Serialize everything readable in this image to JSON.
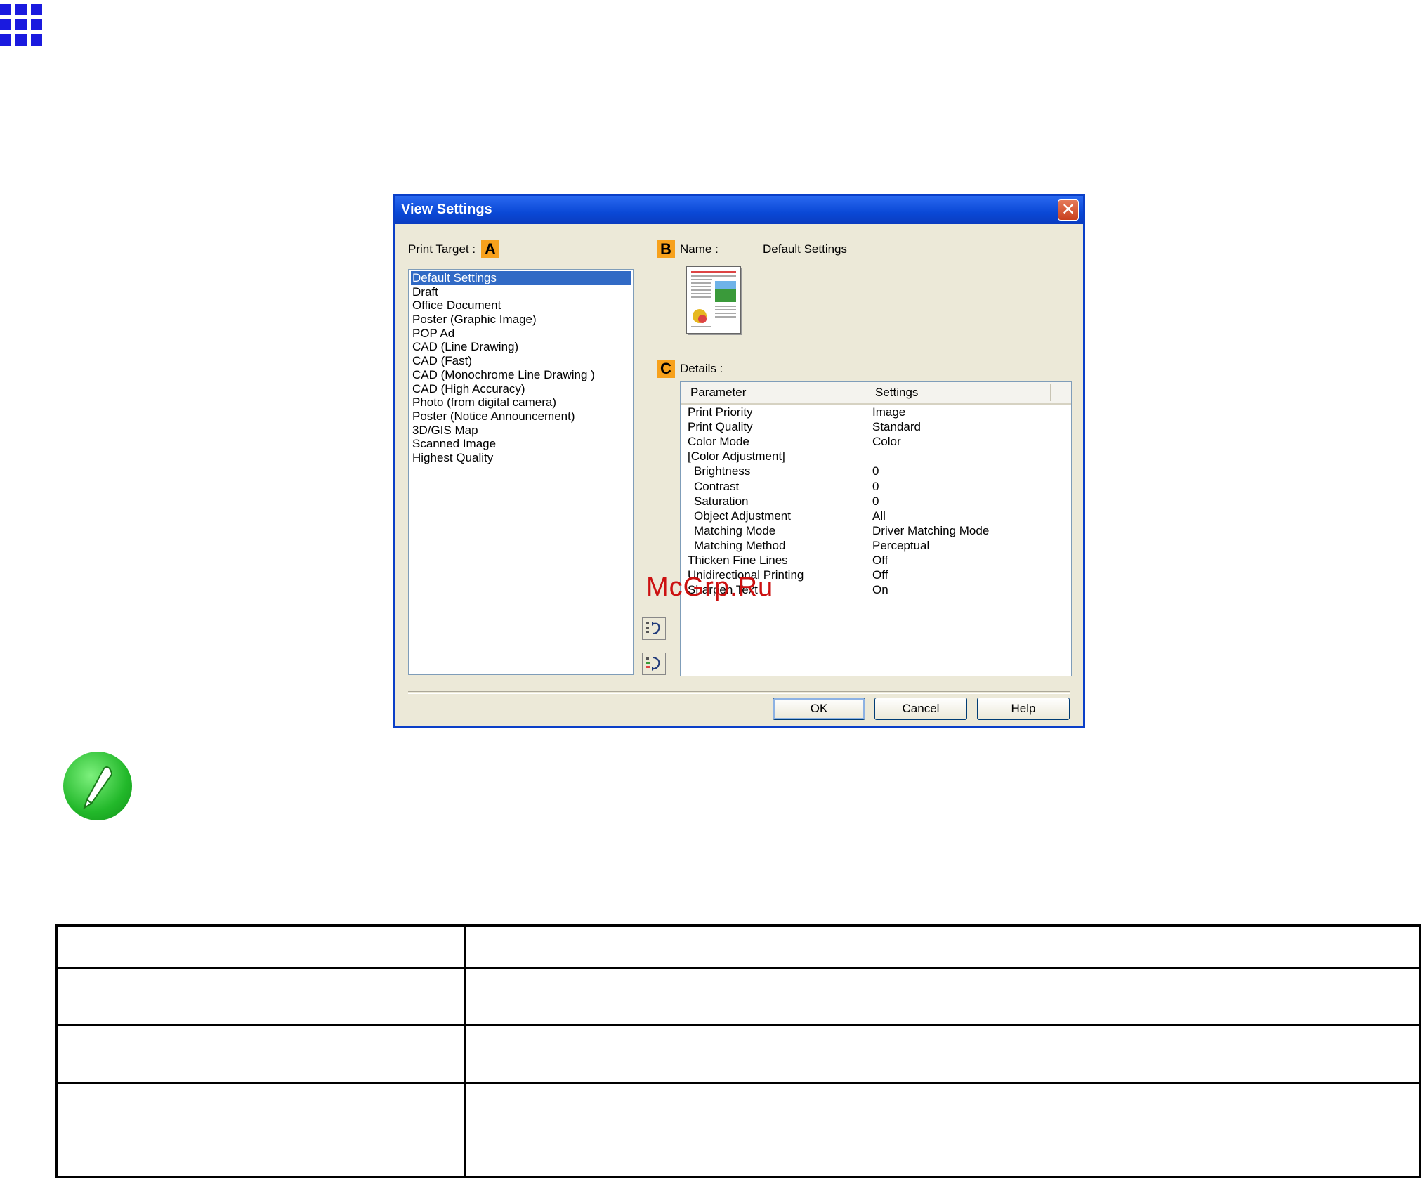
{
  "dialog": {
    "title": "View Settings",
    "close_glyph": "✕"
  },
  "print_target": {
    "label": "Print Target :",
    "badge": "A",
    "items": [
      "Default Settings",
      "Draft",
      "Office Document",
      "Poster (Graphic Image)",
      "POP Ad",
      "CAD (Line Drawing)",
      "CAD (Fast)",
      "CAD (Monochrome Line Drawing )",
      "CAD (High Accuracy)",
      "Photo (from digital camera)",
      "Poster (Notice Announcement)",
      "3D/GIS Map",
      "Scanned Image",
      "Highest Quality"
    ],
    "selected_index": 0
  },
  "name": {
    "badge": "B",
    "label": "Name :",
    "value": "Default Settings"
  },
  "details": {
    "badge": "C",
    "label": "Details :",
    "columns": [
      "Parameter",
      "Settings"
    ],
    "rows": [
      {
        "param": "Print Priority",
        "setting": "Image",
        "indent": false
      },
      {
        "param": "Print Quality",
        "setting": "Standard",
        "indent": false
      },
      {
        "param": "Color Mode",
        "setting": "Color",
        "indent": false
      },
      {
        "param": "[Color Adjustment]",
        "setting": "",
        "indent": false
      },
      {
        "param": "Brightness",
        "setting": "0",
        "indent": true
      },
      {
        "param": "Contrast",
        "setting": "0",
        "indent": true
      },
      {
        "param": "Saturation",
        "setting": "0",
        "indent": true
      },
      {
        "param": "Object Adjustment",
        "setting": "All",
        "indent": true
      },
      {
        "param": "Matching Mode",
        "setting": "Driver Matching Mode",
        "indent": true
      },
      {
        "param": "Matching Method",
        "setting": "Perceptual",
        "indent": true
      },
      {
        "param": "Thicken Fine Lines",
        "setting": "Off",
        "indent": false
      },
      {
        "param": "Unidirectional Printing",
        "setting": "Off",
        "indent": false
      },
      {
        "param": "Sharpen Text",
        "setting": "On",
        "indent": false
      }
    ]
  },
  "buttons": {
    "ok": "OK",
    "cancel": "Cancel",
    "help": "Help"
  },
  "watermark": "McGrp.Ru",
  "colors": {
    "title_bar": "#0a48d6",
    "badge": "#f7a11c",
    "selection": "#316ac5",
    "grid_icon": "#1a1adf",
    "note_icon": "#22b82a"
  }
}
